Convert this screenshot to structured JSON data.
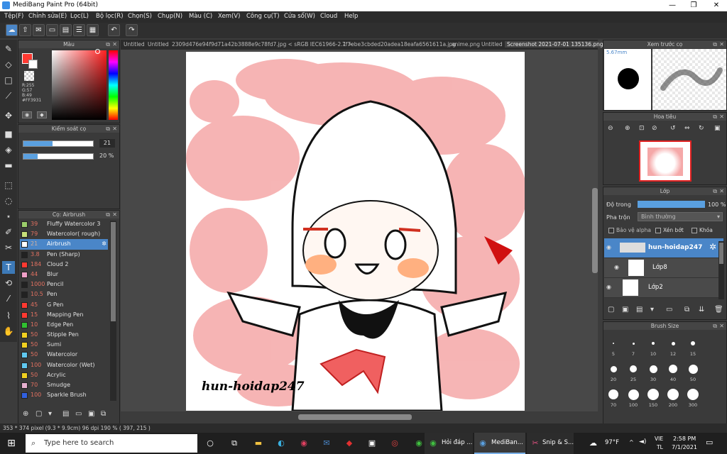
{
  "window": {
    "title": "MediBang Paint Pro (64bit)"
  },
  "menu": [
    "Tệp(F)",
    "Chỉnh sửa(E)",
    "Lọc(L)",
    "Bộ lọc(R)",
    "Chọn(S)",
    "Chụp(N)",
    "Màu (C)",
    "Xem(V)",
    "Công cụ(T)",
    "Cửa sổ(W)",
    "Cloud",
    "Help"
  ],
  "color_panel": {
    "title": "Màu",
    "r": "R:255",
    "g": "G:57",
    "b": "B:49",
    "hex": "#FF3931",
    "primary": "#ff3931"
  },
  "control_panel": {
    "title": "Kiểm soát cọ",
    "size": "21",
    "opacity": "20 %",
    "size_level": 0.42,
    "opacity_level": 0.2
  },
  "brush_panel": {
    "title": "Cọ: Airbrush",
    "items": [
      {
        "size": "39",
        "name": "Fluffy Watercolor 3",
        "color": "#9acd6a"
      },
      {
        "size": "79",
        "name": "Watercolor( rough)",
        "color": "#c8e07a"
      },
      {
        "size": "21",
        "name": "Airbrush",
        "color": "#ffffff",
        "selected": true
      },
      {
        "size": "3.8",
        "name": "Pen (Sharp)",
        "color": "#222222"
      },
      {
        "size": "184",
        "name": "Cloud 2",
        "color": "#ff3931"
      },
      {
        "size": "44",
        "name": "Blur",
        "color": "#f0a0c8"
      },
      {
        "size": "1000",
        "name": "Pencil",
        "color": "#222222"
      },
      {
        "size": "10.5",
        "name": "Pen",
        "color": "#222222"
      },
      {
        "size": "45",
        "name": "G Pen",
        "color": "#ff3931"
      },
      {
        "size": "15",
        "name": "Mapping Pen",
        "color": "#ff3931"
      },
      {
        "size": "10",
        "name": "Edge Pen",
        "color": "#30c030"
      },
      {
        "size": "50",
        "name": "Stipple Pen",
        "color": "#f0d020"
      },
      {
        "size": "50",
        "name": "Sumi",
        "color": "#f0d020"
      },
      {
        "size": "50",
        "name": "Watercolor",
        "color": "#60c8f0"
      },
      {
        "size": "100",
        "name": "Watercolor (Wet)",
        "color": "#60c8f0"
      },
      {
        "size": "50",
        "name": "Acrylic",
        "color": "#f0d020"
      },
      {
        "size": "70",
        "name": "Smudge",
        "color": "#e8b0d0"
      },
      {
        "size": "100",
        "name": "Sparkle Brush",
        "color": "#3060e0"
      }
    ]
  },
  "tabs": [
    "Untitled",
    "Untitled",
    "2309d476e94f9d71a42b3888e9c78fd7.jpg < sRGB IEC61966-2.1 >",
    "7f7ebe3cbded20adea18eafa6561611a.jpg",
    "anime.png",
    "Untitled",
    "Screenshot 2021-07-01 135136.png"
  ],
  "canvas": {
    "signature": "hun-hoidap247"
  },
  "preview_panel": {
    "title": "Xem trước cọ",
    "size": "5.67mm"
  },
  "navigator_panel": {
    "title": "Hoa tiêu"
  },
  "layer_panel": {
    "title": "Lớp",
    "opacity_label": "Độ trong",
    "opacity_value": "100 %",
    "blend_label": "Pha trộn",
    "blend_value": "Bình thường",
    "protect_alpha": "Bảo vệ alpha",
    "clipping": "Xén bớt",
    "lock": "Khóa",
    "layers": [
      {
        "name": "hun-hoidap247",
        "selected": true
      },
      {
        "name": "Lớp8",
        "selected": false
      },
      {
        "name": "Lớp2",
        "selected": false
      }
    ]
  },
  "brush_size_panel": {
    "title": "Brush Size",
    "sizes": [
      "5",
      "7",
      "10",
      "12",
      "15",
      "20",
      "25",
      "30",
      "40",
      "50",
      "70",
      "100",
      "150",
      "200",
      "300"
    ]
  },
  "status": {
    "text": "353 * 374 pixel   (9.3 * 9.9cm)   96 dpi   190 %   ( 397, 215 )"
  },
  "taskbar": {
    "search_placeholder": "Type here to search",
    "app1": "Hỏi đáp ...",
    "app2": "MediBan...",
    "app3": "Snip & S...",
    "weather": "97°F",
    "lang1": "VIE",
    "lang2": "TL",
    "time": "2:58 PM",
    "date": "7/1/2021"
  }
}
